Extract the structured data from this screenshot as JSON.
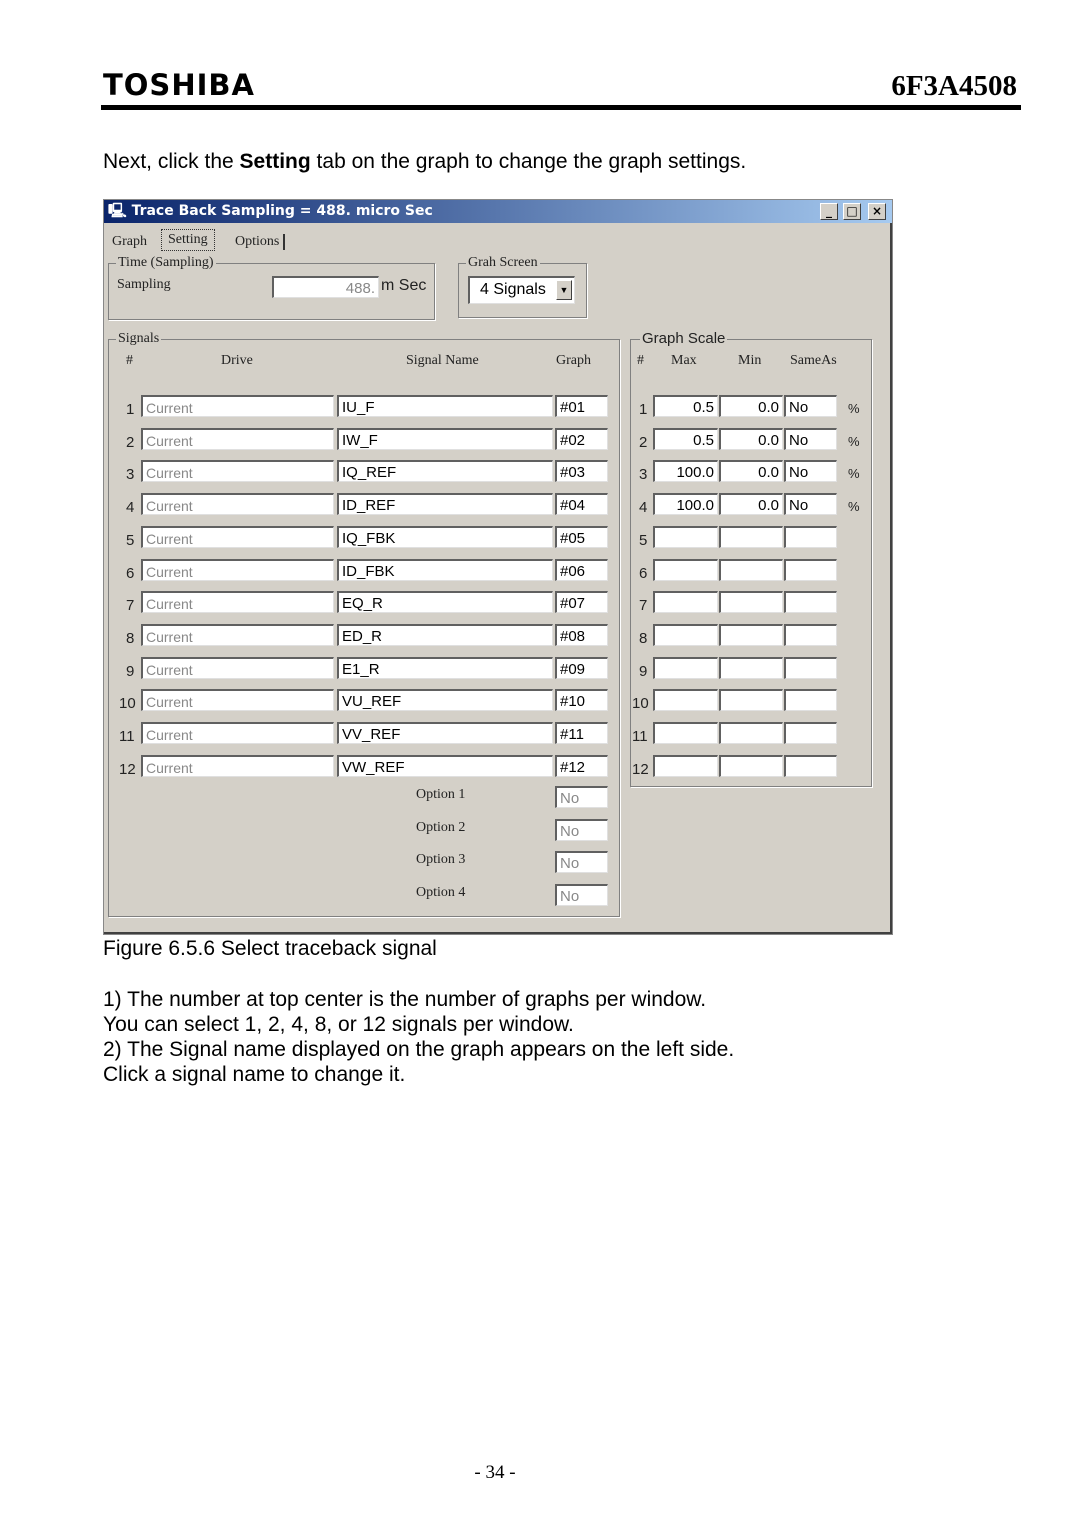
{
  "header": {
    "brand": "TOSHIBA",
    "doc_number": "6F3A4508"
  },
  "intro": {
    "pre": "Next, click the ",
    "bold": "Setting",
    "post": " tab on the graph to change the graph settings."
  },
  "window": {
    "title": "Trace Back Sampling = 488. micro Sec",
    "tabs": [
      "Graph",
      "Setting",
      "Options"
    ],
    "active_tab": "Setting",
    "time_group": {
      "label": "Time (Sampling)",
      "sampling_label": "Sampling",
      "sampling_value": "488.",
      "unit": "m Sec"
    },
    "screen_group": {
      "label": "Grah Screen",
      "selected": "4 Signals"
    },
    "signals": {
      "label": "Signals",
      "headers": [
        "#",
        "Drive",
        "Signal Name",
        "Graph"
      ],
      "rows": [
        {
          "n": "1",
          "drive": "Current",
          "name": "IU_F",
          "graph": "#01"
        },
        {
          "n": "2",
          "drive": "Current",
          "name": "IW_F",
          "graph": "#02"
        },
        {
          "n": "3",
          "drive": "Current",
          "name": "IQ_REF",
          "graph": "#03"
        },
        {
          "n": "4",
          "drive": "Current",
          "name": "ID_REF",
          "graph": "#04"
        },
        {
          "n": "5",
          "drive": "Current",
          "name": "IQ_FBK",
          "graph": "#05"
        },
        {
          "n": "6",
          "drive": "Current",
          "name": "ID_FBK",
          "graph": "#06"
        },
        {
          "n": "7",
          "drive": "Current",
          "name": "EQ_R",
          "graph": "#07"
        },
        {
          "n": "8",
          "drive": "Current",
          "name": "ED_R",
          "graph": "#08"
        },
        {
          "n": "9",
          "drive": "Current",
          "name": "E1_R",
          "graph": "#09"
        },
        {
          "n": "10",
          "drive": "Current",
          "name": "VU_REF",
          "graph": "#10"
        },
        {
          "n": "11",
          "drive": "Current",
          "name": "VV_REF",
          "graph": "#11"
        },
        {
          "n": "12",
          "drive": "Current",
          "name": "VW_REF",
          "graph": "#12"
        }
      ],
      "options": [
        {
          "label": "Option 1",
          "value": "No"
        },
        {
          "label": "Option 2",
          "value": "No"
        },
        {
          "label": "Option 3",
          "value": "No"
        },
        {
          "label": "Option 4",
          "value": "No"
        }
      ]
    },
    "scale": {
      "label": "Graph Scale",
      "headers": [
        "#",
        "Max",
        "Min",
        "SameAs"
      ],
      "unit": "%",
      "rows": [
        {
          "n": "1",
          "max": "0.5",
          "min": "0.0",
          "same": "No",
          "unit": "%"
        },
        {
          "n": "2",
          "max": "0.5",
          "min": "0.0",
          "same": "No",
          "unit": "%"
        },
        {
          "n": "3",
          "max": "100.0",
          "min": "0.0",
          "same": "No",
          "unit": "%"
        },
        {
          "n": "4",
          "max": "100.0",
          "min": "0.0",
          "same": "No",
          "unit": "%"
        },
        {
          "n": "5",
          "max": "",
          "min": "",
          "same": ""
        },
        {
          "n": "6",
          "max": "",
          "min": "",
          "same": ""
        },
        {
          "n": "7",
          "max": "",
          "min": "",
          "same": ""
        },
        {
          "n": "8",
          "max": "",
          "min": "",
          "same": ""
        },
        {
          "n": "9",
          "max": "",
          "min": "",
          "same": ""
        },
        {
          "n": "10",
          "max": "",
          "min": "",
          "same": ""
        },
        {
          "n": "11",
          "max": "",
          "min": "",
          "same": ""
        },
        {
          "n": "12",
          "max": "",
          "min": "",
          "same": ""
        }
      ]
    }
  },
  "caption": "Figure 6.5.6 Select traceback signal",
  "notes": [
    "1) The number at top center is the number of graphs per window.",
    "You can select 1, 2, 4, 8, or 12 signals per window.",
    "2) The Signal name displayed on the graph appears on the left side.",
    "Click a signal name to change it."
  ],
  "footer": {
    "page": "- 34 -"
  }
}
